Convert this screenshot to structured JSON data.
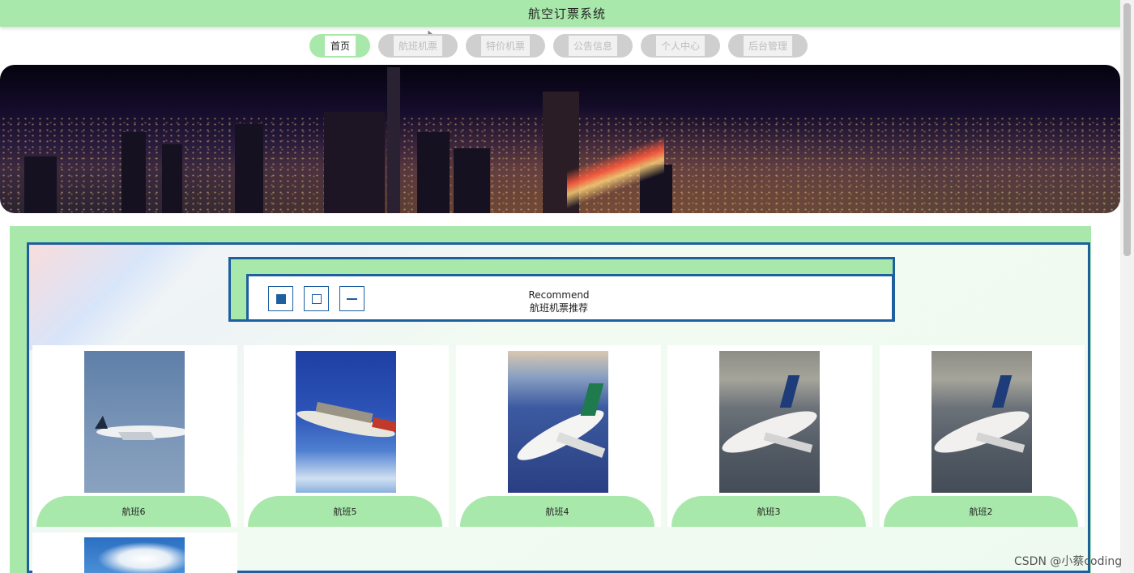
{
  "app": {
    "title": "航空订票系统"
  },
  "nav": {
    "items": [
      {
        "label": "首页",
        "active": true
      },
      {
        "label": "航班机票",
        "active": false
      },
      {
        "label": "特价机票",
        "active": false
      },
      {
        "label": "公告信息",
        "active": false
      },
      {
        "label": "个人中心",
        "active": false
      },
      {
        "label": "后台管理",
        "active": false
      }
    ]
  },
  "section": {
    "title_en": "Recommend",
    "title_zh": "航班机票推荐"
  },
  "flights": [
    {
      "name": "航班6"
    },
    {
      "name": "航班5"
    },
    {
      "name": "航班4"
    },
    {
      "name": "航班3"
    },
    {
      "name": "航班2"
    }
  ],
  "watermark": "CSDN @小蔡coding",
  "colors": {
    "accent_green": "#a9e8ab",
    "border_blue": "#1e5fa0"
  }
}
